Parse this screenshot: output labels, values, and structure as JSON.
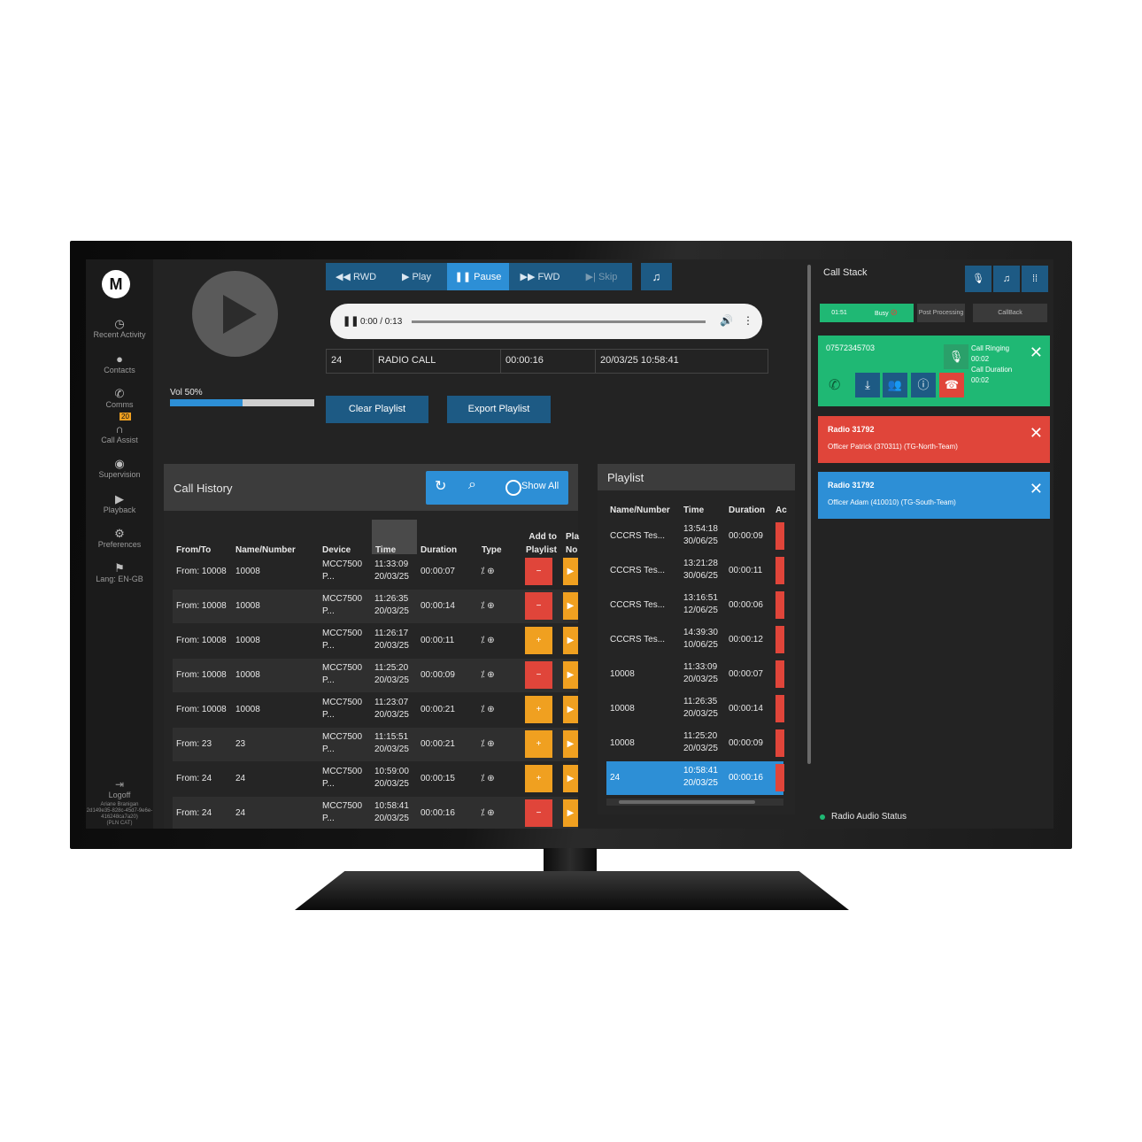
{
  "sidebar": {
    "logo": "M",
    "items": [
      {
        "icon": "clock-icon",
        "glyph": "◷",
        "label": "Recent Activity"
      },
      {
        "icon": "person-icon",
        "glyph": "●",
        "label": "Contacts"
      },
      {
        "icon": "phone-icon",
        "glyph": "✆",
        "label": "Comms"
      },
      {
        "icon": "headset-icon",
        "glyph": "∩",
        "label": "Call Assist"
      },
      {
        "icon": "eye-icon",
        "glyph": "◉",
        "label": "Supervision"
      },
      {
        "icon": "play-circle-icon",
        "glyph": "▶",
        "label": "Playback"
      },
      {
        "icon": "gear-icon",
        "glyph": "⚙",
        "label": "Preferences"
      },
      {
        "icon": "flag-icon",
        "glyph": "⚑",
        "label": "Lang: EN-GB"
      }
    ],
    "comms_badge": "20",
    "logoff": "Logoff",
    "user_name": "Ariane Branigan",
    "user_id": "2d149e35-828c-45d7-9e6e-416248ca7a20)",
    "user_extra": "(PLN CAT)"
  },
  "player": {
    "rwd": "◀◀ RWD",
    "play": "▶ Play",
    "pause": "❚❚ Pause",
    "fwd": "▶▶ FWD",
    "skip": "▶| Skip",
    "headphones": "♫",
    "pause_glyph": "❚❚",
    "time": "0:00 / 0:13",
    "vol_glyph": "🔊",
    "more_glyph": "⋮",
    "info": {
      "number": "24",
      "type": "RADIO CALL",
      "duration": "00:00:16",
      "datetime": "20/03/25 10:58:41"
    },
    "volume_label": "Vol 50%",
    "volume": 0.5,
    "clear_playlist": "Clear Playlist",
    "export_playlist": "Export Playlist"
  },
  "call_history": {
    "title": "Call History",
    "refresh_glyph": "↻",
    "search_glyph": "⌕",
    "show_all": "Show All",
    "columns": {
      "from_to": "From/To",
      "name": "Name/Number",
      "device": "Device",
      "time": "Time",
      "duration": "Duration",
      "type": "Type",
      "add1": "Add to",
      "add2": "Playlist",
      "pl1": "Pla",
      "pl2": "No"
    },
    "rows": [
      {
        "from": "From: 10008",
        "name": "10008",
        "device1": "MCC7500",
        "device2": "P...",
        "time": "11:33:09",
        "date": "20/03/25",
        "duration": "00:00:07",
        "type": "⁒ ⊕",
        "action": "−"
      },
      {
        "from": "From: 10008",
        "name": "10008",
        "device1": "MCC7500",
        "device2": "P...",
        "time": "11:26:35",
        "date": "20/03/25",
        "duration": "00:00:14",
        "type": "⁒ ⊕",
        "action": "−"
      },
      {
        "from": "From: 10008",
        "name": "10008",
        "device1": "MCC7500",
        "device2": "P...",
        "time": "11:26:17",
        "date": "20/03/25",
        "duration": "00:00:11",
        "type": "⁒ ⊕",
        "action": "+"
      },
      {
        "from": "From: 10008",
        "name": "10008",
        "device1": "MCC7500",
        "device2": "P...",
        "time": "11:25:20",
        "date": "20/03/25",
        "duration": "00:00:09",
        "type": "⁒ ⊕",
        "action": "−"
      },
      {
        "from": "From: 10008",
        "name": "10008",
        "device1": "MCC7500",
        "device2": "P...",
        "time": "11:23:07",
        "date": "20/03/25",
        "duration": "00:00:21",
        "type": "⁒ ⊕",
        "action": "+"
      },
      {
        "from": "From: 23",
        "name": "23",
        "device1": "MCC7500",
        "device2": "P...",
        "time": "11:15:51",
        "date": "20/03/25",
        "duration": "00:00:21",
        "type": "⁒ ⊕",
        "action": "+"
      },
      {
        "from": "From: 24",
        "name": "24",
        "device1": "MCC7500",
        "device2": "P...",
        "time": "10:59:00",
        "date": "20/03/25",
        "duration": "00:00:15",
        "type": "⁒ ⊕",
        "action": "+"
      },
      {
        "from": "From: 24",
        "name": "24",
        "device1": "MCC7500",
        "device2": "P...",
        "time": "10:58:41",
        "date": "20/03/25",
        "duration": "00:00:16",
        "type": "⁒ ⊕",
        "action": "−"
      }
    ]
  },
  "playlist": {
    "title": "Playlist",
    "columns": {
      "name": "Name/Number",
      "time": "Time",
      "duration": "Duration",
      "extra": "Ac"
    },
    "rows": [
      {
        "name": "CCCRS Tes...",
        "time": "13:54:18",
        "date": "30/06/25",
        "duration": "00:00:09"
      },
      {
        "name": "CCCRS Tes...",
        "time": "13:21:28",
        "date": "30/06/25",
        "duration": "00:00:11"
      },
      {
        "name": "CCCRS Tes...",
        "time": "13:16:51",
        "date": "12/06/25",
        "duration": "00:00:06"
      },
      {
        "name": "CCCRS Tes...",
        "time": "14:39:30",
        "date": "10/06/25",
        "duration": "00:00:12"
      },
      {
        "name": "10008",
        "time": "11:33:09",
        "date": "20/03/25",
        "duration": "00:00:07"
      },
      {
        "name": "10008",
        "time": "11:26:35",
        "date": "20/03/25",
        "duration": "00:00:14"
      },
      {
        "name": "10008",
        "time": "11:25:20",
        "date": "20/03/25",
        "duration": "00:00:09"
      },
      {
        "name": "24",
        "time": "10:58:41",
        "date": "20/03/25",
        "duration": "00:00:16"
      }
    ]
  },
  "call_stack": {
    "title": "Call Stack",
    "mic_glyph": "🎙",
    "headset_glyph": "♫",
    "keypad_glyph": "⁞⁞",
    "tabs": {
      "timer": "01:51",
      "busy": "Busy",
      "busy_glyph": "⊘",
      "post": "Post Processing",
      "callback": "CallBack"
    },
    "active_call": {
      "number": "07572345703",
      "status": "Call Ringing",
      "ring_time": "00:02",
      "duration_label": "Call Duration",
      "duration": "00:02",
      "phone_glyph": "✆",
      "download_glyph": "⤓",
      "group_glyph": "👥",
      "info_glyph": "ⓘ",
      "hangup_glyph": "☎",
      "mic_glyph": "🎙"
    },
    "radio_cards": [
      {
        "title": "Radio 31792",
        "detail": "Officer Patrick (370311) (TG-North-Team)",
        "color": "#e0453a"
      },
      {
        "title": "Radio 31792",
        "detail": "Officer Adam (410010) (TG-South-Team)",
        "color": "#2d8fd6"
      }
    ],
    "close_glyph": "✕",
    "radio_audio_status": "Radio Audio Status"
  }
}
